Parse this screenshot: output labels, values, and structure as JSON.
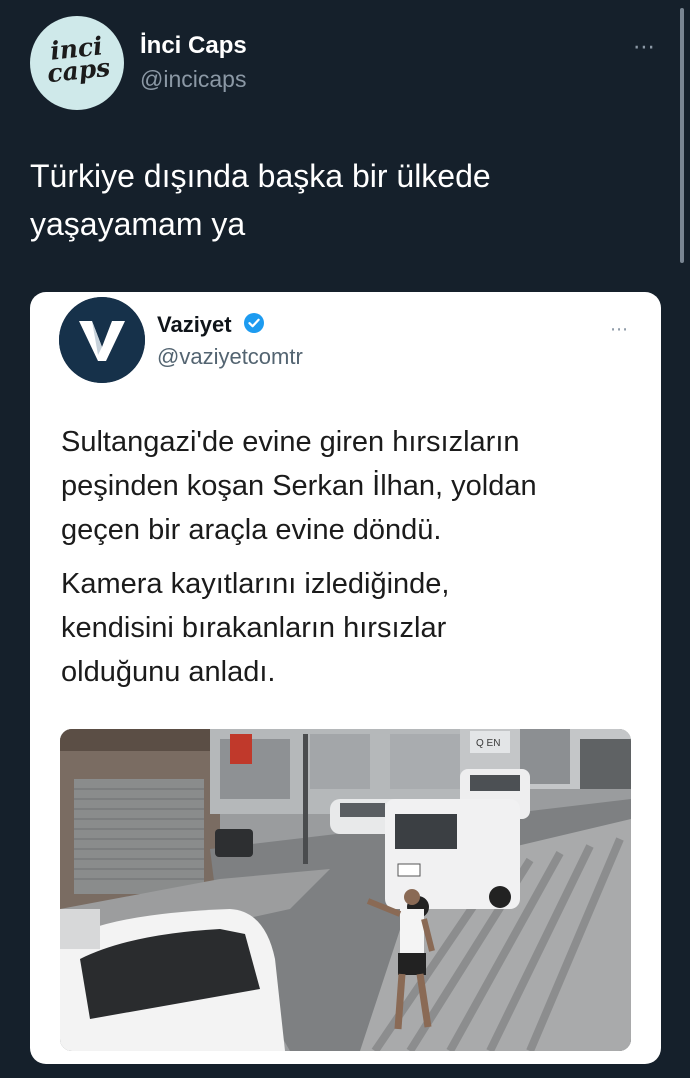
{
  "tweet": {
    "author_name": "İnci Caps",
    "author_handle": "@incicaps",
    "avatar_text_line1": "inci",
    "avatar_text_line2": "caps",
    "more_icon": "⋯",
    "text_line1": "Türkiye dışında başka bir ülkede",
    "text_line2": "yaşayamam ya"
  },
  "quoted": {
    "author_name": "Vaziyet",
    "verified": true,
    "author_handle": "@vaziyetcomtr",
    "more_icon": "⋯",
    "para1_line1": "Sultangazi'de evine giren hırsızların",
    "para1_line2": "peşinden koşan Serkan İlhan, yoldan",
    "para1_line3": "geçen bir araçla evine döndü.",
    "para2_line1": "Kamera kayıtlarını izlediğinde,",
    "para2_line2": "kendisini bırakanların hırsızlar",
    "para2_line3": "olduğunu anladı.",
    "media_sign_text": "Q EN",
    "accent_color": "#1d9bf0"
  },
  "colors": {
    "background": "#15202b",
    "text_primary": "#ffffff",
    "text_secondary": "#8b98a5"
  }
}
